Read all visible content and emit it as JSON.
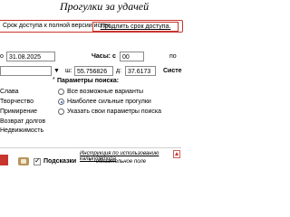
{
  "title": "Прогулки за удачей",
  "notice": {
    "text": "Срок доступа к полной версии истек.",
    "link": "Продлить срок доступа."
  },
  "form": {
    "date_label": "о",
    "date_value": "31.08.2025",
    "hours_label": "Часы: с",
    "hours_value": "00",
    "to_label": "по",
    "lat_label": "ш:",
    "lat_value": "55.756826",
    "lon_label": "д:",
    "lon_value": "37.6173",
    "system_label": "Систе"
  },
  "goals": [
    "Слава",
    "Творчество",
    "Примирение",
    "Возврат долгов",
    "Недвижимость"
  ],
  "search_params": {
    "label": "Параметры поиска:",
    "options": [
      "Все возможные варианты",
      "Наиболее сильные прогулки",
      "Указать свои параметры поиска"
    ],
    "selected_index": 1
  },
  "bottom": {
    "hints_label": "Подсказки",
    "instruction_link": "Инструкция по использованию калькулятора",
    "required_note": "* - обязательное поле"
  }
}
